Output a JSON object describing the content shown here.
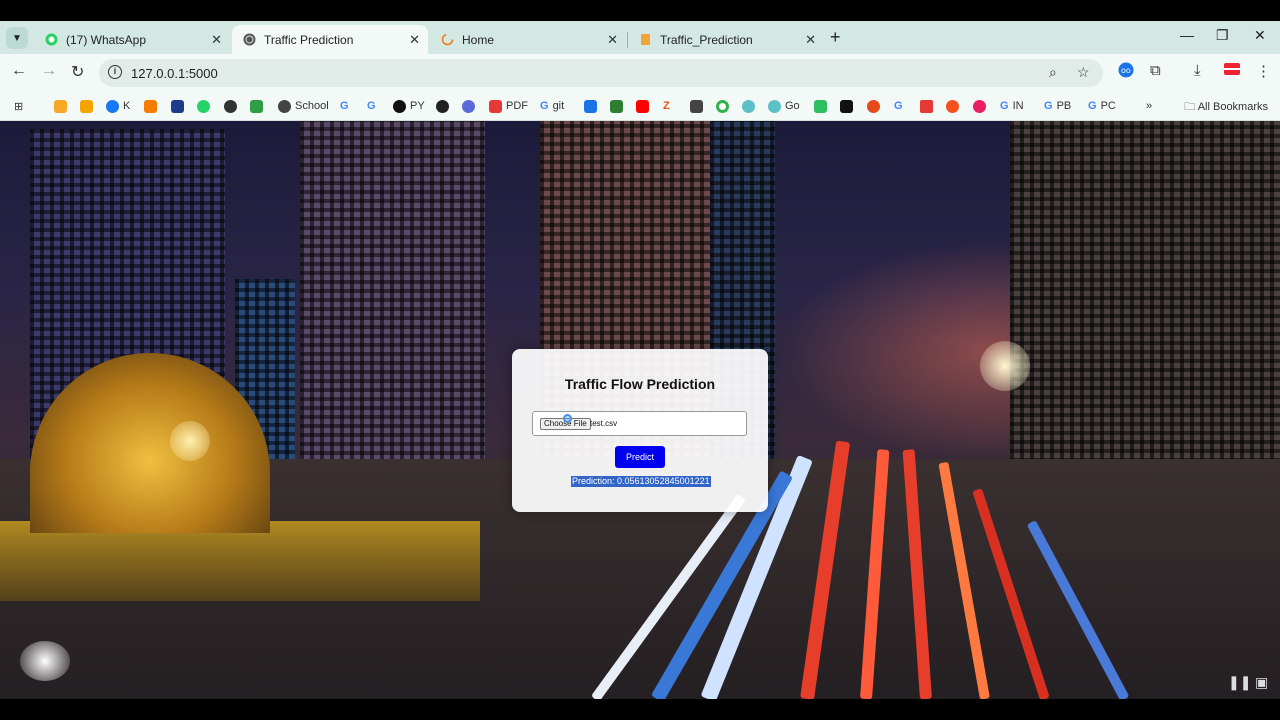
{
  "tabs": [
    {
      "title": "(17) WhatsApp",
      "icon": "whatsapp-icon",
      "active": false
    },
    {
      "title": "Traffic Prediction",
      "icon": "globe-icon",
      "active": true
    },
    {
      "title": "Home",
      "icon": "loading-icon",
      "active": false
    },
    {
      "title": "Traffic_Prediction",
      "icon": "notebook-icon",
      "active": false
    }
  ],
  "address_bar": {
    "url": "127.0.0.1:5000"
  },
  "bookmarks": {
    "items": [
      "K",
      "School",
      "PY",
      "PDF",
      "git",
      "Go",
      "IN",
      "PB",
      "PC"
    ],
    "all_label": "All Bookmarks"
  },
  "card": {
    "title": "Traffic Flow Prediction",
    "choose_file_label": "Choose File",
    "file_name": "test.csv",
    "predict_label": "Predict",
    "result": "Prediction: 0.05613052845001221"
  },
  "colors": {
    "tab_strip": "#d3e8e3",
    "toolbar": "#f3f9f7",
    "predict_button": "#0000ee",
    "selection": "#3166c8"
  }
}
